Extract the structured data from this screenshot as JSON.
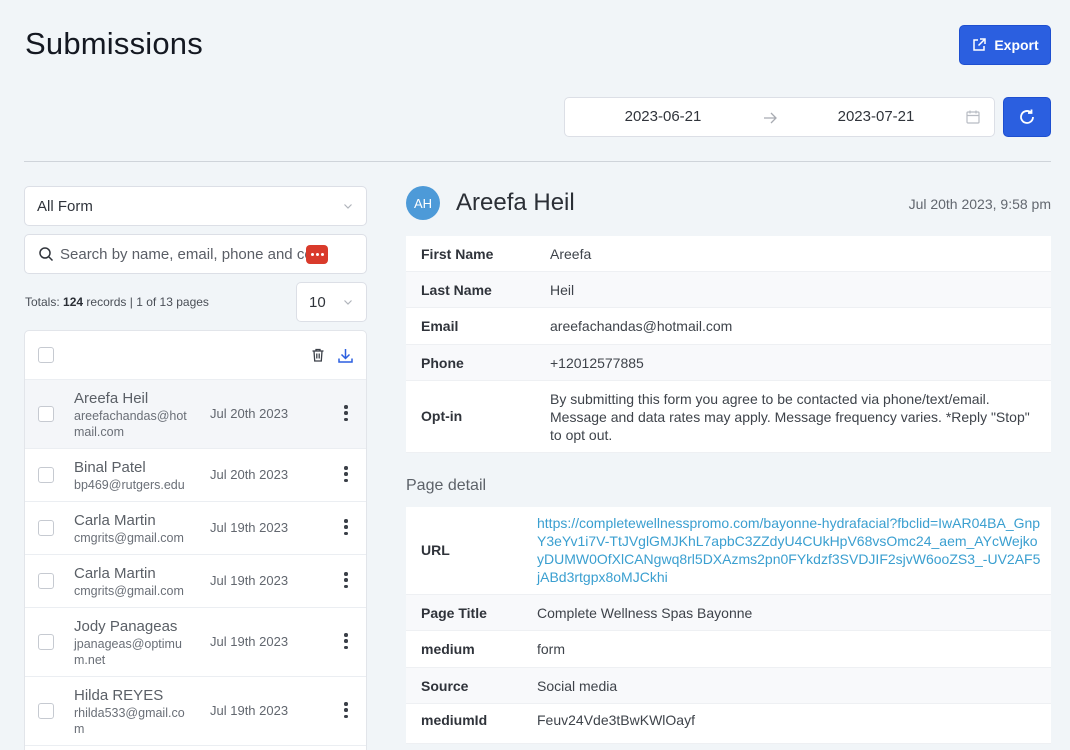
{
  "header": {
    "title": "Submissions",
    "export_label": "Export"
  },
  "date_range": {
    "start": "2023-06-21",
    "end": "2023-07-21"
  },
  "filters": {
    "form_select": "All Form",
    "search_placeholder": "Search by name, email, phone and co",
    "page_size": "10"
  },
  "totals": {
    "label": "Totals:",
    "count": "124",
    "suffix": "records | 1 of 13 pages"
  },
  "submissions": [
    {
      "name": "Areefa Heil",
      "email": "areefachandas@hotmail.com",
      "date": "Jul 20th 2023"
    },
    {
      "name": "Binal Patel",
      "email": "bp469@rutgers.edu",
      "date": "Jul 20th 2023"
    },
    {
      "name": "Carla Martin",
      "email": "cmgrits@gmail.com",
      "date": "Jul 19th 2023"
    },
    {
      "name": "Carla Martin",
      "email": "cmgrits@gmail.com",
      "date": "Jul 19th 2023"
    },
    {
      "name": "Jody Panageas",
      "email": "jpanageas@optimum.net",
      "date": "Jul 19th 2023"
    },
    {
      "name": "Hilda REYES",
      "email": "rhilda533@gmail.com",
      "date": "Jul 19th 2023"
    }
  ],
  "detail": {
    "initials": "AH",
    "name": "Areefa Heil",
    "submitted_at": "Jul 20th 2023, 9:58 pm",
    "fields": [
      {
        "label": "First Name",
        "value": "Areefa"
      },
      {
        "label": "Last Name",
        "value": "Heil"
      },
      {
        "label": "Email",
        "value": "areefachandas@hotmail.com"
      },
      {
        "label": "Phone",
        "value": "+12012577885"
      },
      {
        "label": "Opt-in",
        "value": "By submitting this form you agree to be contacted via phone/text/email. Message and data rates may apply. Message frequency varies. *Reply \"Stop\" to opt out."
      }
    ],
    "page_detail_title": "Page detail",
    "page_fields": [
      {
        "label": "URL",
        "value": "https://completewellnesspromo.com/bayonne-hydrafacial?fbclid=IwAR04BA_GnpY3eYv1i7V-TtJVglGMJKhL7apbC3ZZdyU4CUkHpV68vsOmc24_aem_AYcWejkoyDUMW0OfXlCANgwq8rl5DXAzms2pn0FYkdzf3SVDJIF2sjvW6ooZS3_-UV2AF5jABd3rtgpx8oMJCkhi"
      },
      {
        "label": "Page Title",
        "value": "Complete Wellness Spas Bayonne"
      },
      {
        "label": "medium",
        "value": "form"
      },
      {
        "label": "Source",
        "value": "Social media"
      },
      {
        "label": "mediumId",
        "value": "Feuv24Vde3tBwKWlOayf"
      }
    ]
  },
  "colors": {
    "primary": "#2b5fe0",
    "link": "#3a9fd0",
    "avatar": "#4d9ad8",
    "badge": "#d93a2b"
  }
}
